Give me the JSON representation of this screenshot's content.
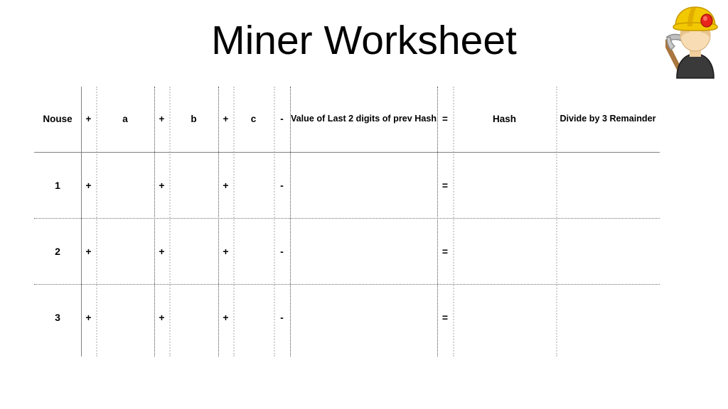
{
  "page": {
    "title": "Miner Worksheet",
    "background_color": "#ffffff",
    "text_color": "#000000"
  },
  "avatar": {
    "name": "miner-avatar",
    "icon": "miner-with-pickaxe-icon",
    "helmet_color": "#F2C800",
    "helmet_shade_color": "#D9A400",
    "lamp_color": "#E8251C",
    "skin_color": "#F7DCB4",
    "hair_color": "#E8C48E",
    "body_color": "#3A3A3A",
    "pick_handle_color": "#A9763F",
    "pick_head_color": "#BFBFBF"
  },
  "table": {
    "name": "miner-worksheet-table",
    "headers": [
      "Nouse",
      "+",
      "a",
      "+",
      "b",
      "+",
      "c",
      "-",
      "Value of Last 2 digits of prev Hash",
      "=",
      "Hash",
      "Divide by 3 Remainder"
    ],
    "rows": [
      {
        "nonce": "1",
        "op1": "+",
        "a": "",
        "op2": "+",
        "b": "",
        "op3": "+",
        "c": "",
        "op4": "-",
        "prev_hash_last2": "",
        "op5": "=",
        "hash": "",
        "remainder": ""
      },
      {
        "nonce": "2",
        "op1": "+",
        "a": "",
        "op2": "+",
        "b": "",
        "op3": "+",
        "c": "",
        "op4": "-",
        "prev_hash_last2": "",
        "op5": "=",
        "hash": "",
        "remainder": ""
      },
      {
        "nonce": "3",
        "op1": "+",
        "a": "",
        "op2": "+",
        "b": "",
        "op3": "+",
        "c": "",
        "op4": "-",
        "prev_hash_last2": "",
        "op5": "=",
        "hash": "",
        "remainder": ""
      }
    ],
    "rule_colors": {
      "header_rule": "#808080",
      "row_rule": "#6e6e6e",
      "vertical_solid": "#808080",
      "vertical_dark_dotted": "#4d4d4d",
      "vertical_light_dotted": "#d2d2d2"
    }
  }
}
